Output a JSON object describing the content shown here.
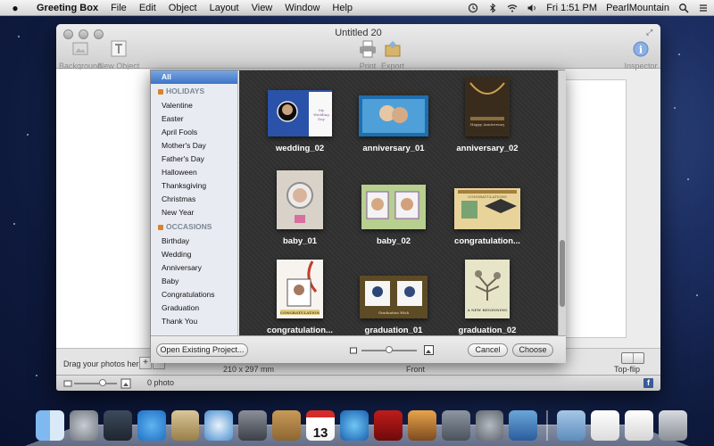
{
  "menubar": {
    "apple": "",
    "app_name": "Greeting Box",
    "menus": [
      "File",
      "Edit",
      "Object",
      "Layout",
      "View",
      "Window",
      "Help"
    ],
    "clock": "Fri 1:51 PM",
    "user": "PearlMountain"
  },
  "window": {
    "title": "Untitled 20",
    "toolbar": {
      "background_label": "Background",
      "new_object_label": "New Object",
      "print_label": "Print",
      "export_label": "Export",
      "inspector_label": "Inspector"
    },
    "bottom": {
      "drag_label": "Drag your photos here",
      "add_symbol": "+",
      "remove_symbol": "−",
      "size_label": "210 x 297 mm",
      "side_label": "Front",
      "flip_label": "Top-flip"
    },
    "status": {
      "photo_count": "0 photo",
      "facebook": "f"
    }
  },
  "sheet": {
    "categories": [
      {
        "type": "item",
        "label": "All",
        "selected": true
      },
      {
        "type": "group",
        "label": "HOLIDAYS"
      },
      {
        "type": "item",
        "label": "Valentine"
      },
      {
        "type": "item",
        "label": "Easter"
      },
      {
        "type": "item",
        "label": "April Fools"
      },
      {
        "type": "item",
        "label": "Mother's Day"
      },
      {
        "type": "item",
        "label": "Father's Day"
      },
      {
        "type": "item",
        "label": "Halloween"
      },
      {
        "type": "item",
        "label": "Thanksgiving"
      },
      {
        "type": "item",
        "label": "Christmas"
      },
      {
        "type": "item",
        "label": "New Year"
      },
      {
        "type": "group",
        "label": "OCCASIONS"
      },
      {
        "type": "item",
        "label": "Birthday"
      },
      {
        "type": "item",
        "label": "Wedding"
      },
      {
        "type": "item",
        "label": "Anniversary"
      },
      {
        "type": "item",
        "label": "Baby"
      },
      {
        "type": "item",
        "label": "Congratulations"
      },
      {
        "type": "item",
        "label": "Graduation"
      },
      {
        "type": "item",
        "label": "Thank You"
      }
    ],
    "templates": [
      {
        "label": "wedding_02",
        "style": "wedding",
        "card_text": "My Wedding Day"
      },
      {
        "label": "anniversary_01",
        "style": "anniv1",
        "card_text": ""
      },
      {
        "label": "anniversary_02",
        "style": "anniv2",
        "card_text": "Happy Anniversary"
      },
      {
        "label": "baby_01",
        "style": "baby1",
        "card_text": ""
      },
      {
        "label": "baby_02",
        "style": "baby2",
        "card_text": ""
      },
      {
        "label": "congratulation...",
        "style": "congr1",
        "card_text": "CONGRATULATIONS"
      },
      {
        "label": "congratulation...",
        "style": "congr2",
        "card_text": "CONGRATULATIONS"
      },
      {
        "label": "graduation_01",
        "style": "grad1",
        "card_text": "Graduation Wish"
      },
      {
        "label": "graduation_02",
        "style": "grad2",
        "card_text": "A NEW BEGINNING"
      }
    ],
    "open_existing_label": "Open Existing Project...",
    "cancel_label": "Cancel",
    "choose_label": "Choose",
    "zoom_level": 0.5
  },
  "dock": {
    "items": [
      "finder-icon",
      "launchpad-icon",
      "mission-control-icon",
      "app-store-icon",
      "mail-stamp-icon",
      "safari-icon",
      "facetime-icon",
      "contacts-icon",
      "calendar-icon",
      "itunes-icon",
      "photo-booth-icon",
      "iphoto-icon",
      "camera-icon",
      "system-preferences-icon",
      "preview-icon",
      "applications-folder-icon",
      "documents-icon",
      "downloads-icon",
      "trash-icon"
    ],
    "calendar_day": "13"
  }
}
